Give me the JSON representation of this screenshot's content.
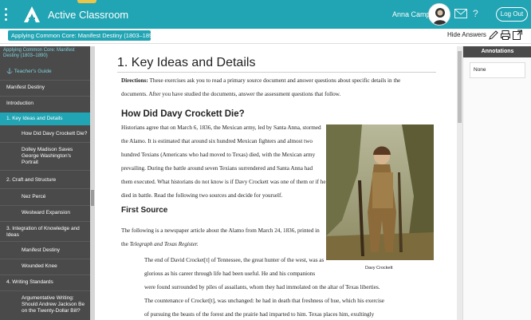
{
  "header": {
    "app_title": "Active Classroom",
    "user_name": "Anna Campagna",
    "help": "?",
    "logout": "Log Out"
  },
  "subbar": {
    "breadcrumb": "Applying Common Core: Manifest Destiny (1803–1890)",
    "hide_answers": "Hide Answers"
  },
  "sidebar": {
    "header": "Applying Common Core: Manifest Destiny (1803–1890)",
    "items": [
      {
        "label": "Teacher's Guide"
      },
      {
        "label": "Manifest Destiny"
      },
      {
        "label": "Introduction"
      },
      {
        "label": "1. Key Ideas and Details"
      },
      {
        "label": "How Did Davy Crockett Die?"
      },
      {
        "label": "Dolley Madison Saves George Washington's Portrait"
      },
      {
        "label": "2. Craft and Structure"
      },
      {
        "label": "Nez Percé"
      },
      {
        "label": "Westward Expansion"
      },
      {
        "label": "3. Integration of Knowledge and Ideas"
      },
      {
        "label": "Manifest Destiny"
      },
      {
        "label": "Wounded Knee"
      },
      {
        "label": "4. Writing Standards"
      },
      {
        "label": "Argumentative Writing: Should Andrew Jackson Be on the Twenty-Dollar Bill?"
      }
    ]
  },
  "main": {
    "title": "1. Key Ideas and Details",
    "directions_label": "Directions:",
    "directions_line1": " These exercises ask you to read a primary source document and answer questions about specific details in the",
    "directions_line2": "documents. After you have studied the documents, answer the assessment questions that follow.",
    "section_title": "How Did Davy Crockett Die?",
    "body_lines": [
      "Historians agree that on March 6, 1836, the Mexican army, led by Santa Anna, stormed",
      "the Alamo. It is estimated that around six hundred Mexican fighters and almost two",
      "hundred Texians (Americans who had moved to Texas) died, with the Mexican army",
      "prevailing. During the battle around seven Texians surrendered and Santa Anna had",
      "them executed. What historians do not know is if Davy Crockett was one of them or if he",
      "died in battle. Read the following two sources and decide for yourself."
    ],
    "first_source_title": "First Source",
    "intro_part1": "The following is a newspaper article about the Alamo from March 24, 1836, printed in",
    "intro_part2a": "the ",
    "intro_part2_italic": "Telegraph and Texas Register.",
    "quote_lines": [
      "The end of David Crocket[t] of Tennessee, the great hunter of the west, was as",
      "glorious as his career through life had been useful. He and his companions",
      "were found surrounded by piles of assailants, whom they had immolated on the altar of Texas liberties.",
      "The countenance of Crocket[t], was unchanged: he had in death that freshness of hue, which his exercise",
      "of pursuing the beasts of the forest and the prairie had imparted to him. Texas places him, exultingly"
    ],
    "photo_caption": "Davy Crockett"
  },
  "annotations": {
    "title": "Annotations",
    "value": "None"
  },
  "colors": {
    "brand": "#21a4b3",
    "sidebar": "#4a4a4a"
  }
}
